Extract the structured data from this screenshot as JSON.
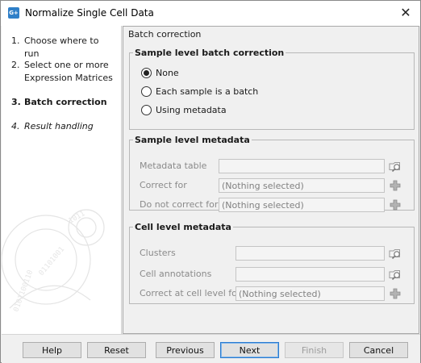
{
  "window": {
    "title": "Normalize Single Cell Data",
    "icon_label": "G+",
    "close_glyph": "✕"
  },
  "sidebar": {
    "steps": [
      {
        "num": "1.",
        "label": "Choose where to run"
      },
      {
        "num": "2.",
        "label": "Select one or more Expression Matrices"
      },
      {
        "num": "3.",
        "label": "Batch correction"
      },
      {
        "num": "4.",
        "label": "Result handling"
      }
    ]
  },
  "panel": {
    "title": "Batch correction",
    "sample_batch": {
      "legend": "Sample level batch correction",
      "options": [
        "None",
        "Each sample is a batch",
        "Using metadata"
      ],
      "selected": "None"
    },
    "sample_metadata": {
      "legend": "Sample level metadata",
      "rows": [
        {
          "label": "Metadata table",
          "value": "",
          "icon": "browse-icon"
        },
        {
          "label": "Correct for",
          "value": "(Nothing selected)",
          "icon": "plus-icon"
        },
        {
          "label": "Do not correct for",
          "value": "(Nothing selected)",
          "icon": "plus-icon"
        }
      ]
    },
    "cell_metadata": {
      "legend": "Cell level metadata",
      "rows": [
        {
          "label": "Clusters",
          "value": "",
          "icon": "browse-icon"
        },
        {
          "label": "Cell annotations",
          "value": "",
          "icon": "browse-icon"
        },
        {
          "label": "Correct at cell level for",
          "value": "(Nothing selected)",
          "icon": "plus-icon"
        }
      ]
    }
  },
  "footer": {
    "help": "Help",
    "reset": "Reset",
    "previous": "Previous",
    "next": "Next",
    "finish": "Finish",
    "cancel": "Cancel"
  },
  "colors": {
    "accent": "#2b7bd0",
    "disabled_text": "#8a8a8a"
  }
}
